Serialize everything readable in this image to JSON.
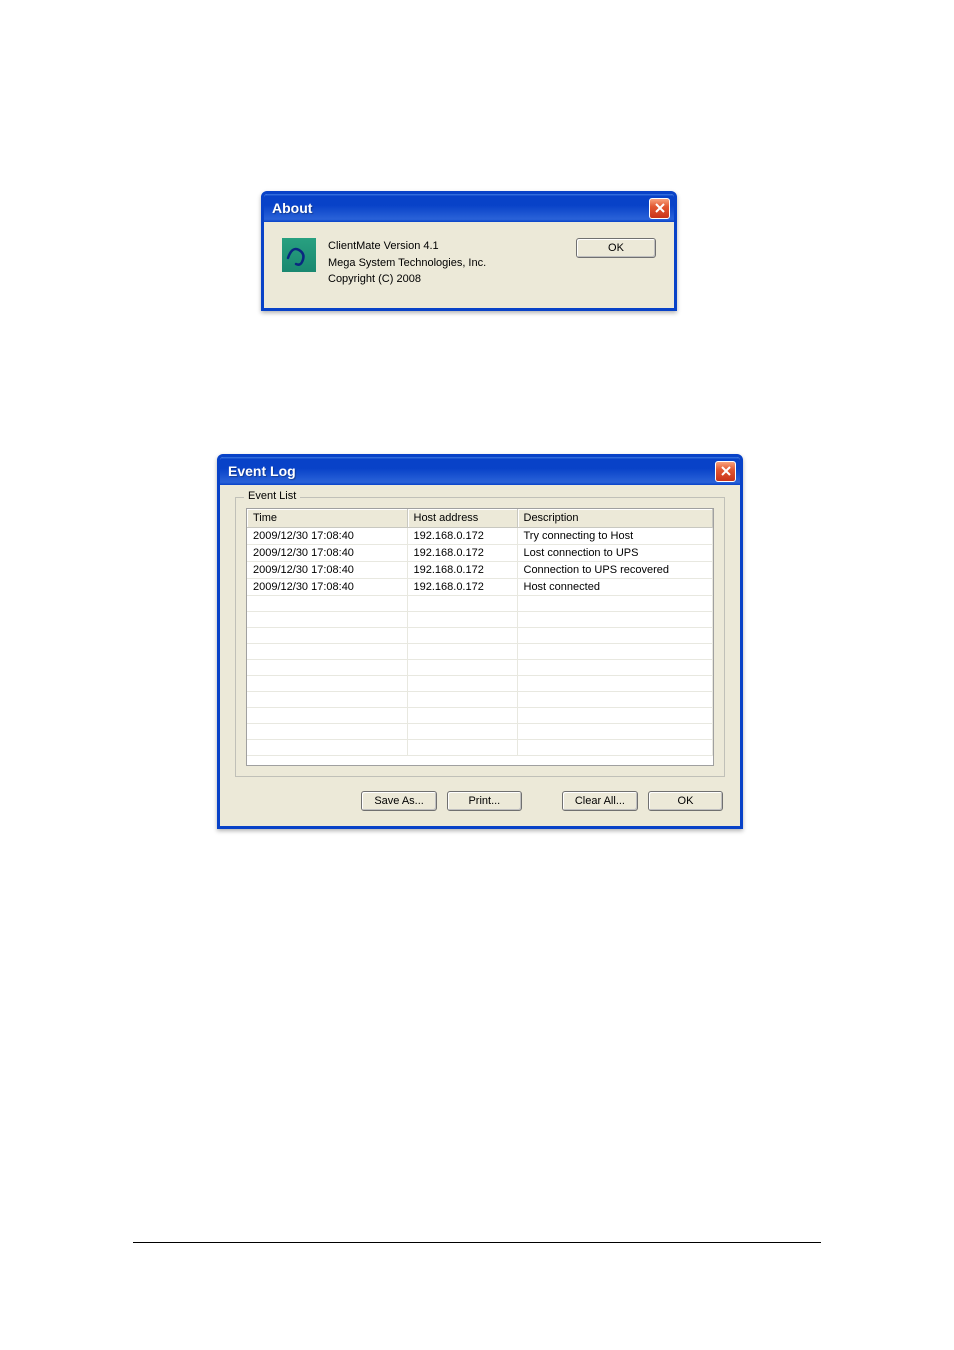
{
  "about": {
    "title": "About",
    "line1": "ClientMate Version 4.1",
    "line2": "Mega System Technologies, Inc.",
    "line3": "Copyright (C) 2008",
    "ok_label": "OK"
  },
  "eventlog": {
    "title": "Event Log",
    "fieldset_label": "Event List",
    "columns": {
      "time": "Time",
      "host": "Host address",
      "description": "Description"
    },
    "rows": [
      {
        "time": "2009/12/30 17:08:40",
        "host": "192.168.0.172",
        "description": "Try connecting to Host"
      },
      {
        "time": "2009/12/30 17:08:40",
        "host": "192.168.0.172",
        "description": "Lost connection to UPS"
      },
      {
        "time": "2009/12/30 17:08:40",
        "host": "192.168.0.172",
        "description": "Connection to UPS recovered"
      },
      {
        "time": "2009/12/30 17:08:40",
        "host": "192.168.0.172",
        "description": "Host connected"
      }
    ],
    "buttons": {
      "save_as": "Save As...",
      "print": "Print...",
      "clear_all": "Clear All...",
      "ok": "OK"
    }
  }
}
